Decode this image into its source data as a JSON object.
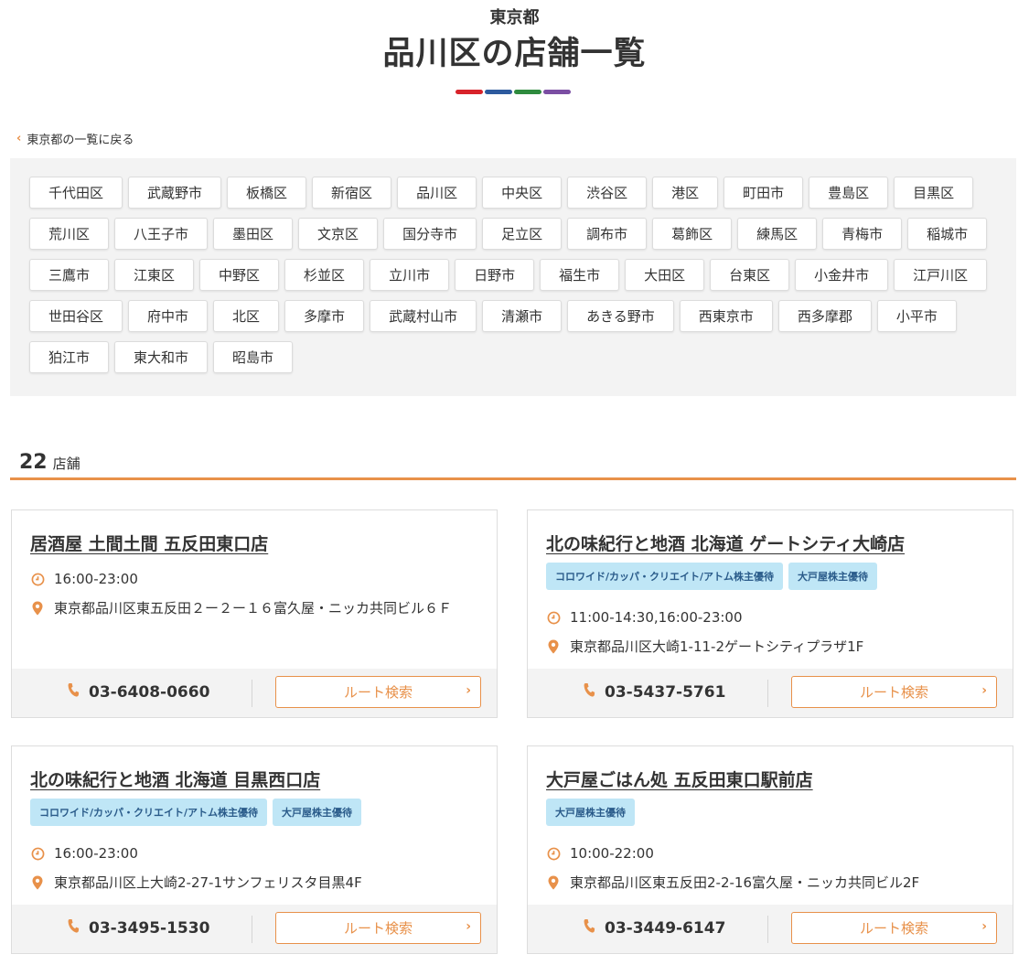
{
  "header": {
    "prefecture": "東京都",
    "title": "品川区の店舗一覧",
    "bar_colors": [
      "#d8232a",
      "#2d5a9e",
      "#2e8b3e",
      "#7b4ea3"
    ]
  },
  "back_link": {
    "label": "東京都の一覧に戻る"
  },
  "areas": [
    "千代田区",
    "武蔵野市",
    "板橋区",
    "新宿区",
    "品川区",
    "中央区",
    "渋谷区",
    "港区",
    "町田市",
    "豊島区",
    "目黒区",
    "荒川区",
    "八王子市",
    "墨田区",
    "文京区",
    "国分寺市",
    "足立区",
    "調布市",
    "葛飾区",
    "練馬区",
    "青梅市",
    "稲城市",
    "三鷹市",
    "江東区",
    "中野区",
    "杉並区",
    "立川市",
    "日野市",
    "福生市",
    "大田区",
    "台東区",
    "小金井市",
    "江戸川区",
    "世田谷区",
    "府中市",
    "北区",
    "多摩市",
    "武蔵村山市",
    "清瀬市",
    "あきる野市",
    "西東京市",
    "西多摩郡",
    "小平市",
    "狛江市",
    "東大和市",
    "昭島市"
  ],
  "count": {
    "number": "22",
    "unit": "店舗"
  },
  "route_label": "ルート検索",
  "stores": [
    {
      "name": "居酒屋 土間土間 五反田東口店",
      "tags": [],
      "hours": "16:00-23:00",
      "address": "東京都品川区東五反田２ー２ー１６富久屋・ニッカ共同ビル６Ｆ",
      "phone": "03-6408-0660"
    },
    {
      "name": "北の味紀行と地酒 北海道 ゲートシティ大崎店",
      "tags": [
        "コロワイド/カッパ・クリエイト/アトム株主優待",
        "大戸屋株主優待"
      ],
      "hours": "11:00-14:30,16:00-23:00",
      "address": "東京都品川区大崎1-11-2ゲートシティプラザ1F",
      "phone": "03-5437-5761"
    },
    {
      "name": "北の味紀行と地酒 北海道 目黒西口店",
      "tags": [
        "コロワイド/カッパ・クリエイト/アトム株主優待",
        "大戸屋株主優待"
      ],
      "hours": "16:00-23:00",
      "address": "東京都品川区上大崎2-27-1サンフェリスタ目黒4F",
      "phone": "03-3495-1530"
    },
    {
      "name": "大戸屋ごはん処 五反田東口駅前店",
      "tags": [
        "大戸屋株主優待"
      ],
      "hours": "10:00-22:00",
      "address": "東京都品川区東五反田2-2-16富久屋・ニッカ共同ビル2F",
      "phone": "03-3449-6147"
    }
  ],
  "colors": {
    "accent": "#e8914a",
    "tag_bg": "#bfe6f6",
    "tag_text": "#2a5b8a"
  }
}
